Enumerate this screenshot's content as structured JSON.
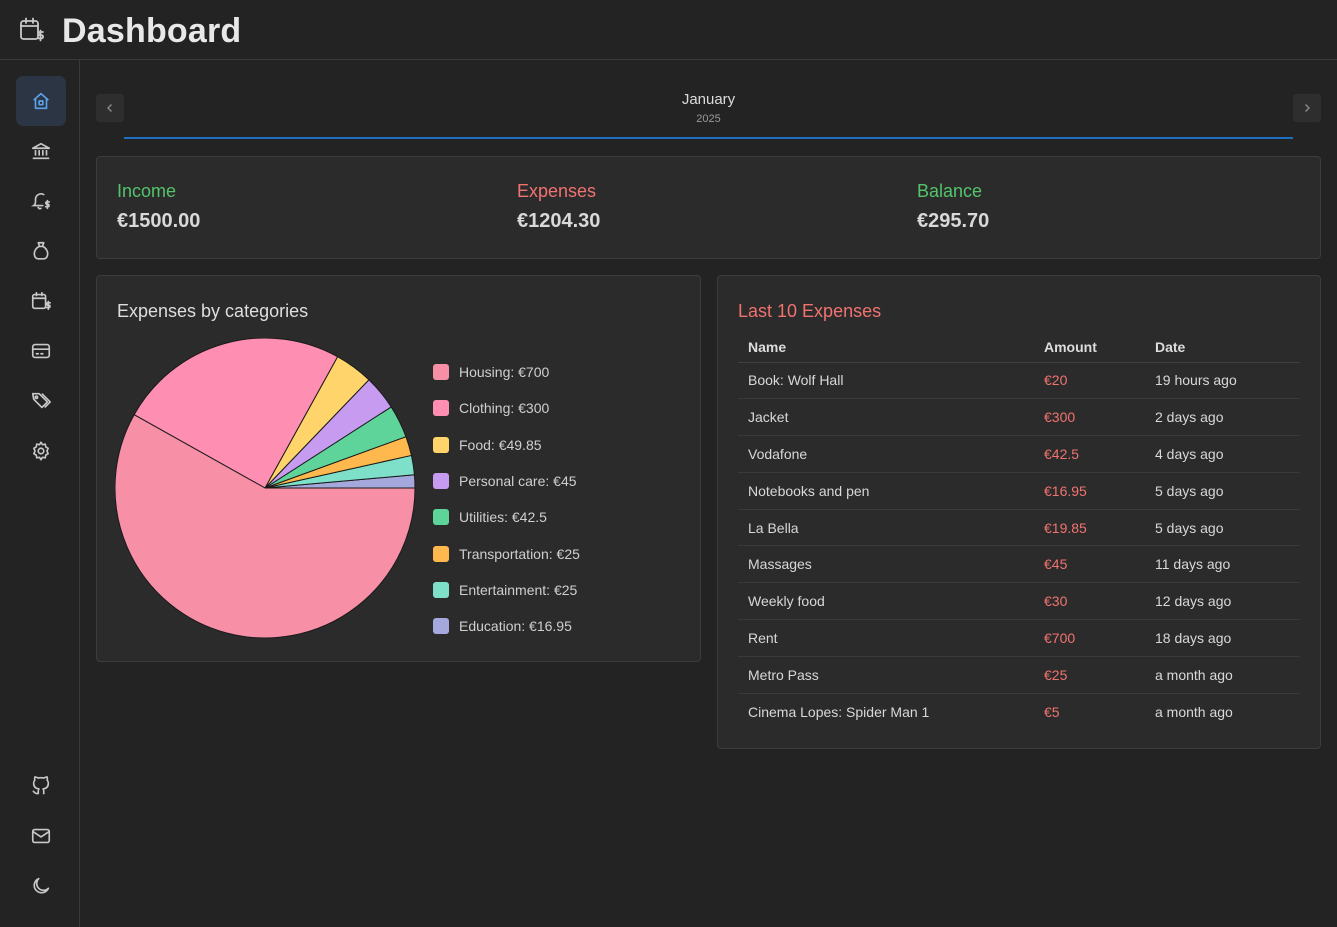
{
  "header": {
    "title": "Dashboard",
    "logo_icon": "calendar-dollar-icon"
  },
  "sidebar": {
    "items": [
      {
        "icon": "home-icon",
        "active": true
      },
      {
        "icon": "bank-icon"
      },
      {
        "icon": "bell-dollar-icon"
      },
      {
        "icon": "money-bag-icon"
      },
      {
        "icon": "calendar-dollar-icon"
      },
      {
        "icon": "credit-card-icon"
      },
      {
        "icon": "tags-icon"
      },
      {
        "icon": "gear-icon"
      }
    ],
    "bottom_items": [
      {
        "icon": "github-icon"
      },
      {
        "icon": "mail-icon"
      },
      {
        "icon": "moon-icon"
      }
    ],
    "active_color": "#5aa3e8"
  },
  "month_nav": {
    "month": "January",
    "year": "2025"
  },
  "summary": {
    "income_label": "Income",
    "income_value": "€1500.00",
    "expenses_label": "Expenses",
    "expenses_value": "€1204.30",
    "balance_label": "Balance",
    "balance_value": "€295.70"
  },
  "category_chart": {
    "title": "Expenses by categories",
    "legend": [
      "Housing: €700",
      "Clothing: €300",
      "Food: €49.85",
      "Personal care: €45",
      "Utilities: €42.5",
      "Transportation: €25",
      "Entertainment: €25",
      "Education: €16.95"
    ]
  },
  "chart_data": {
    "type": "pie",
    "title": "Expenses by categories",
    "categories": [
      "Housing",
      "Clothing",
      "Food",
      "Personal care",
      "Utilities",
      "Transportation",
      "Entertainment",
      "Education"
    ],
    "values": [
      700,
      300,
      49.85,
      45,
      42.5,
      25,
      25,
      16.95
    ],
    "colors": [
      "#f78fa7",
      "#ff8fb2",
      "#ffd56b",
      "#c79cf0",
      "#5ed49b",
      "#ffb84d",
      "#7ee0c8",
      "#a5a8dc"
    ],
    "legend_placement": "right"
  },
  "last_expenses": {
    "title": "Last 10 Expenses",
    "columns": [
      "Name",
      "Amount",
      "Date"
    ],
    "rows": [
      {
        "name": "Book: Wolf Hall",
        "amount": "€20",
        "date": "19 hours ago"
      },
      {
        "name": "Jacket",
        "amount": "€300",
        "date": "2 days ago"
      },
      {
        "name": "Vodafone",
        "amount": "€42.5",
        "date": "4 days ago"
      },
      {
        "name": "Notebooks and pen",
        "amount": "€16.95",
        "date": "5 days ago"
      },
      {
        "name": "La Bella",
        "amount": "€19.85",
        "date": "5 days ago"
      },
      {
        "name": "Massages",
        "amount": "€45",
        "date": "11 days ago"
      },
      {
        "name": "Weekly food",
        "amount": "€30",
        "date": "12 days ago"
      },
      {
        "name": "Rent",
        "amount": "€700",
        "date": "18 days ago"
      },
      {
        "name": "Metro Pass",
        "amount": "€25",
        "date": "a month ago"
      },
      {
        "name": "Cinema Lopes: Spider Man 1",
        "amount": "€5",
        "date": "a month ago"
      }
    ]
  }
}
